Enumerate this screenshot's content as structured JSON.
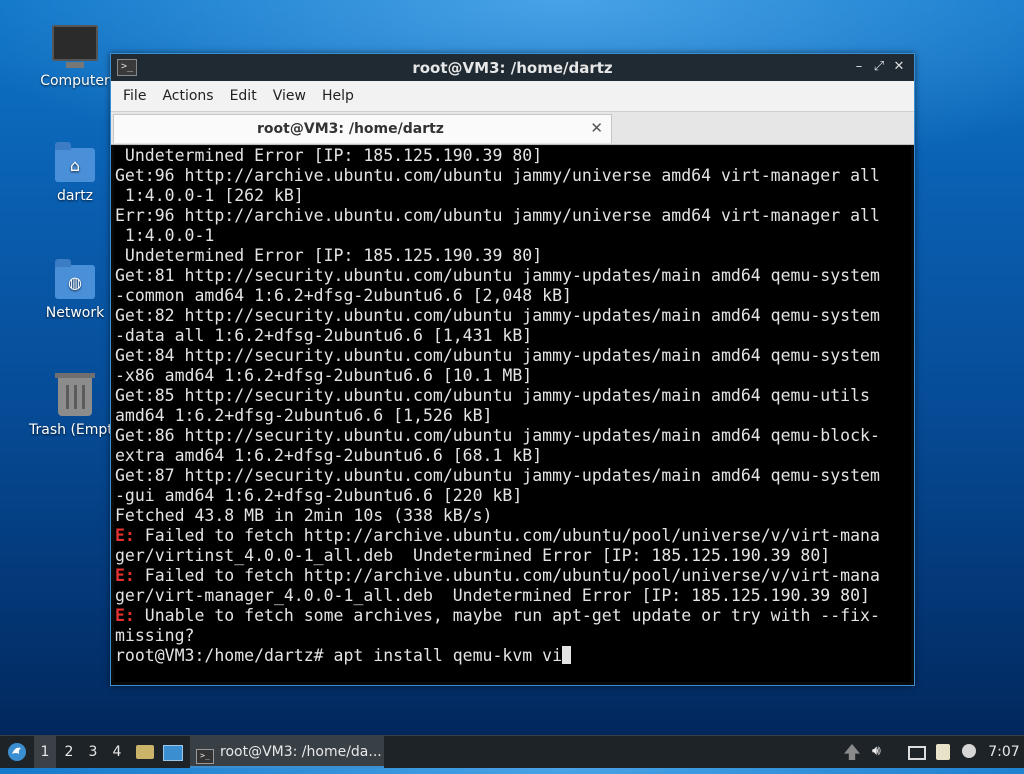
{
  "desktop": {
    "icons": [
      {
        "label": "Computer"
      },
      {
        "label": "dartz"
      },
      {
        "label": "Network"
      },
      {
        "label": "Trash (Empt"
      }
    ]
  },
  "window": {
    "title": "root@VM3: /home/dartz",
    "menu": [
      "File",
      "Actions",
      "Edit",
      "View",
      "Help"
    ],
    "tab_label": "root@VM3: /home/dartz",
    "lines": [
      {
        "text": " Undetermined Error [IP: 185.125.190.39 80]"
      },
      {
        "text": "Get:96 http://archive.ubuntu.com/ubuntu jammy/universe amd64 virt-manager all"
      },
      {
        "text": " 1:4.0.0-1 [262 kB]"
      },
      {
        "text": "Err:96 http://archive.ubuntu.com/ubuntu jammy/universe amd64 virt-manager all"
      },
      {
        "text": " 1:4.0.0-1"
      },
      {
        "text": " Undetermined Error [IP: 185.125.190.39 80]"
      },
      {
        "text": "Get:81 http://security.ubuntu.com/ubuntu jammy-updates/main amd64 qemu-system"
      },
      {
        "text": "-common amd64 1:6.2+dfsg-2ubuntu6.6 [2,048 kB]"
      },
      {
        "text": "Get:82 http://security.ubuntu.com/ubuntu jammy-updates/main amd64 qemu-system"
      },
      {
        "text": "-data all 1:6.2+dfsg-2ubuntu6.6 [1,431 kB]"
      },
      {
        "text": "Get:84 http://security.ubuntu.com/ubuntu jammy-updates/main amd64 qemu-system"
      },
      {
        "text": "-x86 amd64 1:6.2+dfsg-2ubuntu6.6 [10.1 MB]"
      },
      {
        "text": "Get:85 http://security.ubuntu.com/ubuntu jammy-updates/main amd64 qemu-utils"
      },
      {
        "text": "amd64 1:6.2+dfsg-2ubuntu6.6 [1,526 kB]"
      },
      {
        "text": "Get:86 http://security.ubuntu.com/ubuntu jammy-updates/main amd64 qemu-block-"
      },
      {
        "text": "extra amd64 1:6.2+dfsg-2ubuntu6.6 [68.1 kB]"
      },
      {
        "text": "Get:87 http://security.ubuntu.com/ubuntu jammy-updates/main amd64 qemu-system"
      },
      {
        "text": "-gui amd64 1:6.2+dfsg-2ubuntu6.6 [220 kB]"
      },
      {
        "text": "Fetched 43.8 MB in 2min 10s (338 kB/s)"
      },
      {
        "prefix": "E:",
        "text": " Failed to fetch http://archive.ubuntu.com/ubuntu/pool/universe/v/virt-mana"
      },
      {
        "text": "ger/virtinst_4.0.0-1_all.deb  Undetermined Error [IP: 185.125.190.39 80]"
      },
      {
        "prefix": "E:",
        "text": " Failed to fetch http://archive.ubuntu.com/ubuntu/pool/universe/v/virt-mana"
      },
      {
        "text": "ger/virt-manager_4.0.0-1_all.deb  Undetermined Error [IP: 185.125.190.39 80]"
      },
      {
        "prefix": "E:",
        "text": " Unable to fetch some archives, maybe run apt-get update or try with --fix-"
      },
      {
        "text": "missing?"
      }
    ],
    "prompt": "root@VM3:/home/dartz# ",
    "command": "apt install qemu-kvm vi"
  },
  "taskbar": {
    "workspaces": [
      "1",
      "2",
      "3",
      "4"
    ],
    "active_workspace": "1",
    "task_label": "root@VM3: /home/da...",
    "clock": "7:07"
  },
  "colors": {
    "error": "#e53030",
    "accent": "#3b8fd0"
  }
}
